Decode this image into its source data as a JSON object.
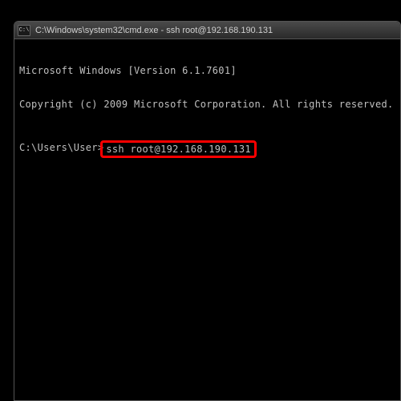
{
  "window": {
    "icon_label": "C:\\",
    "title": "C:\\Windows\\system32\\cmd.exe - ssh  root@192.168.190.131"
  },
  "terminal": {
    "line1": "Microsoft Windows [Version 6.1.7601]",
    "line2": "Copyright (c) 2009 Microsoft Corporation.  All rights reserved.",
    "prompt": "C:\\Users\\User>",
    "command": "ssh root@192.168.190.131"
  }
}
